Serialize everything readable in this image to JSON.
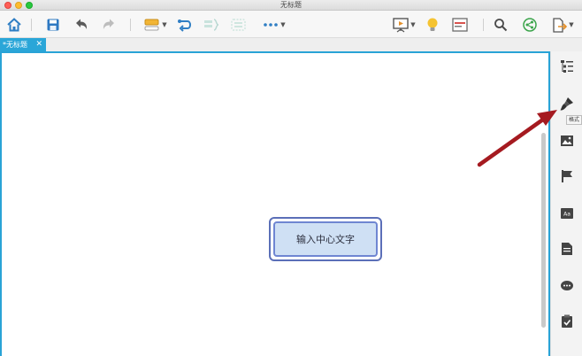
{
  "window": {
    "title": "无标题"
  },
  "toolbar": {
    "items": [
      "home-icon",
      "save-icon",
      "undo-icon",
      "redo-icon",
      "topic-style-icon",
      "relationship-icon",
      "summary-icon",
      "boundary-icon",
      "more-icon",
      "presentation-icon",
      "idea-icon",
      "outline-view-icon",
      "search-icon",
      "share-icon",
      "export-icon"
    ]
  },
  "tabs": [
    {
      "label": "*无标题",
      "close": "✕"
    }
  ],
  "canvas": {
    "central_topic": "输入中心文字"
  },
  "sidebar": {
    "items": [
      "outline-icon",
      "format-brush-icon",
      "image-icon",
      "flag-icon",
      "text-style-icon",
      "notes-icon",
      "comment-icon",
      "task-icon"
    ],
    "tooltip": "格式"
  },
  "colors": {
    "accent": "#29a3d6",
    "arrow": "#b01c22",
    "topic_fill": "#cfe0f4",
    "topic_border": "#5b6fb8"
  }
}
